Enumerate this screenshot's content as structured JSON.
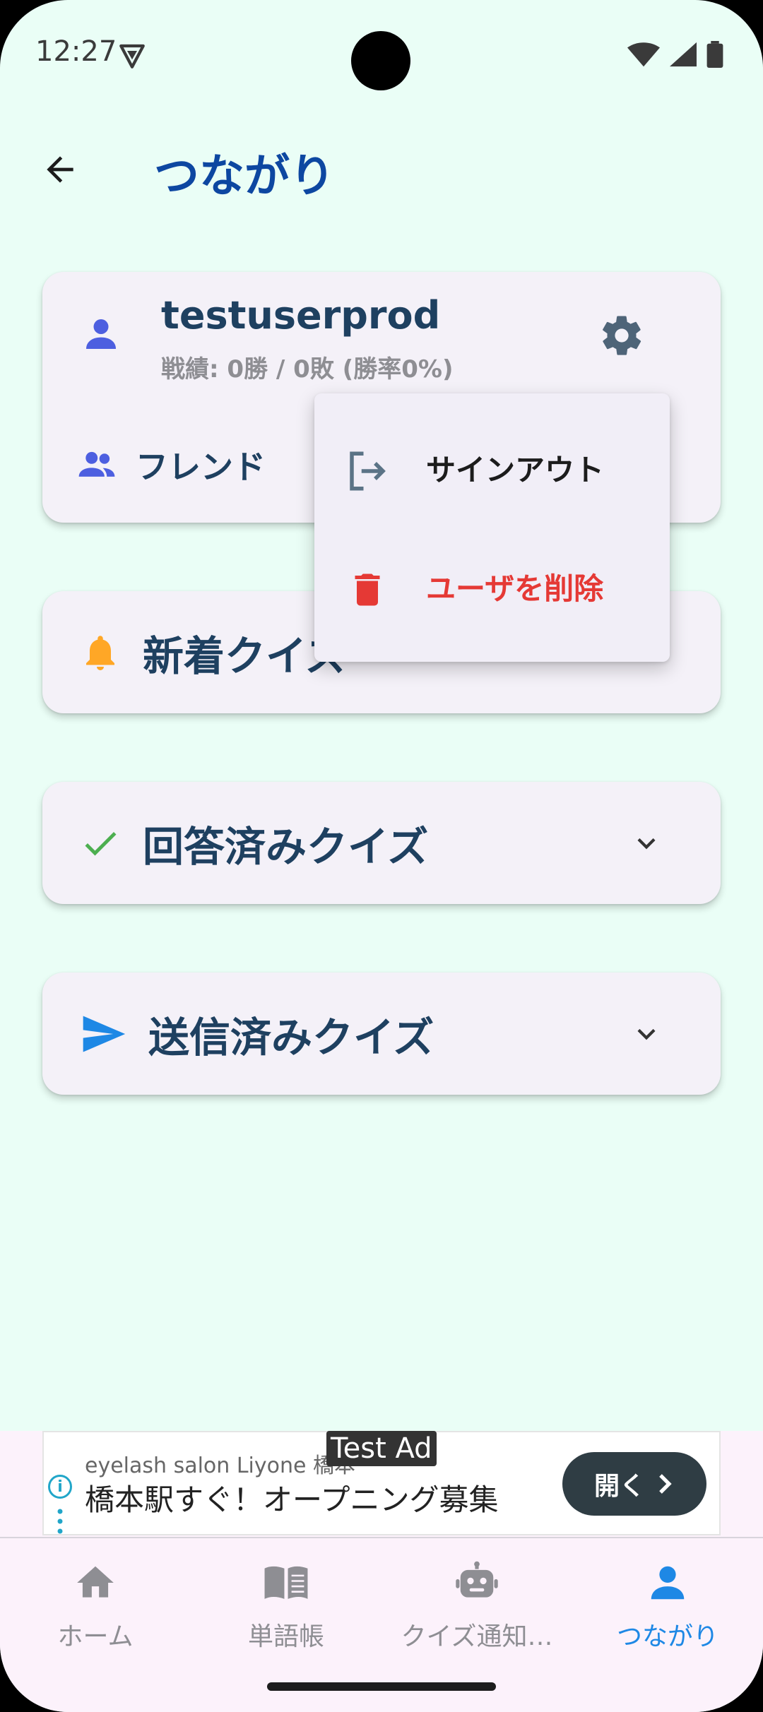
{
  "status_bar": {
    "time": "12:27"
  },
  "header": {
    "title": "つながり"
  },
  "profile": {
    "username": "testuserprod",
    "record": "戦績: 0勝 / 0敗 (勝率0%)",
    "friends_label": "フレンド"
  },
  "sections": {
    "new_quiz": "新着クイズ",
    "answered_quiz": "回答済みクイズ",
    "sent_quiz": "送信済みクイズ"
  },
  "menu": {
    "sign_out": "サインアウト",
    "delete_user": "ユーザを削除"
  },
  "ad": {
    "tag": "Test Ad",
    "subtitle": "eyelash salon Liyone 橋本",
    "headline": "橋本駅すぐ！オープニング募集",
    "button": "開く"
  },
  "nav": {
    "items": [
      {
        "label": "ホーム",
        "icon": "home-icon"
      },
      {
        "label": "単語帳",
        "icon": "book-icon"
      },
      {
        "label": "クイズ通知…",
        "icon": "robot-icon"
      },
      {
        "label": "つながり",
        "icon": "person-icon"
      }
    ]
  },
  "colors": {
    "background": "#EAFEF6",
    "title": "#0D47A1",
    "accent": "#1E88E5",
    "danger": "#E53935",
    "bell": "#FFA726",
    "check": "#4CAF50"
  }
}
